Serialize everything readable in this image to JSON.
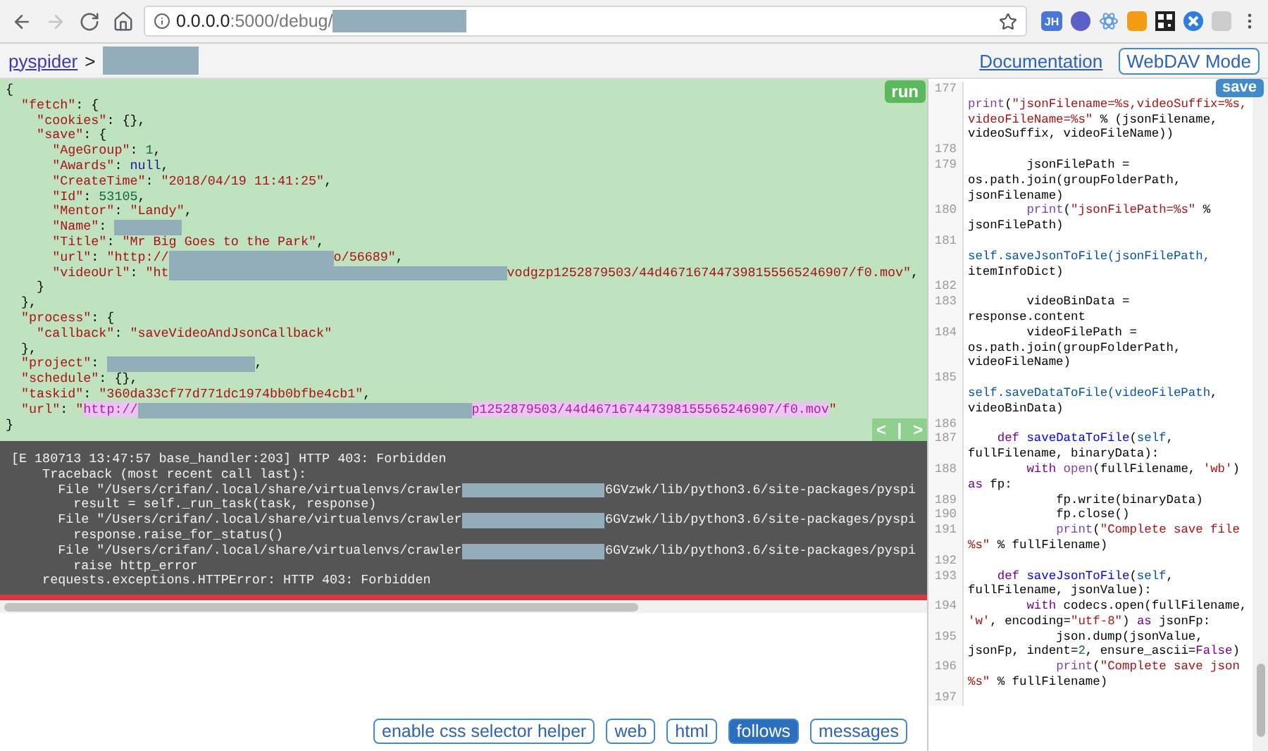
{
  "browser": {
    "nav_buttons": [
      {
        "kind": "back",
        "disabled": false
      },
      {
        "kind": "forward",
        "disabled": true
      },
      {
        "kind": "reload",
        "disabled": false
      },
      {
        "kind": "home",
        "disabled": false
      }
    ],
    "url": [
      {
        "kind": "host",
        "text": "0.0.0.0"
      },
      {
        "kind": "path",
        "text": ":5000/debug/"
      },
      {
        "kind": "redacted"
      }
    ],
    "extension_badge": "JH"
  },
  "header": {
    "breadcrumb": [
      {
        "kind": "link",
        "text": "pyspider"
      },
      {
        "kind": "text",
        "text": ">"
      },
      {
        "kind": "redacted"
      }
    ],
    "documentation_link": "Documentation",
    "webdav_button": "WebDAV Mode"
  },
  "task_editor": {
    "run_button": "run",
    "nav": [
      "<",
      "|",
      ">"
    ],
    "lines": [
      [
        {
          "kind": "plain",
          "text": "{"
        }
      ],
      [
        {
          "kind": "string",
          "text": "  \"fetch\""
        },
        {
          "kind": "plain",
          "text": ": {"
        }
      ],
      [
        {
          "kind": "string",
          "text": "    \"cookies\""
        },
        {
          "kind": "plain",
          "text": ": {},"
        }
      ],
      [
        {
          "kind": "string",
          "text": "    \"save\""
        },
        {
          "kind": "plain",
          "text": ": {"
        }
      ],
      [
        {
          "kind": "string",
          "text": "      \"AgeGroup\""
        },
        {
          "kind": "plain",
          "text": ": "
        },
        {
          "kind": "number",
          "text": "1"
        },
        {
          "kind": "plain",
          "text": ","
        }
      ],
      [
        {
          "kind": "string",
          "text": "      \"Awards\""
        },
        {
          "kind": "plain",
          "text": ": "
        },
        {
          "kind": "atom",
          "text": "null"
        },
        {
          "kind": "plain",
          "text": ","
        }
      ],
      [
        {
          "kind": "string",
          "text": "      \"CreateTime\""
        },
        {
          "kind": "plain",
          "text": ": "
        },
        {
          "kind": "string",
          "text": "\"2018/04/19 11:41:25\""
        },
        {
          "kind": "plain",
          "text": ","
        }
      ],
      [
        {
          "kind": "string",
          "text": "      \"Id\""
        },
        {
          "kind": "plain",
          "text": ": "
        },
        {
          "kind": "number",
          "text": "53105"
        },
        {
          "kind": "plain",
          "text": ","
        }
      ],
      [
        {
          "kind": "string",
          "text": "      \"Mentor\""
        },
        {
          "kind": "plain",
          "text": ": "
        },
        {
          "kind": "string",
          "text": "\"Landy\""
        },
        {
          "kind": "plain",
          "text": ","
        }
      ],
      [
        {
          "kind": "string",
          "text": "      \"Name\""
        },
        {
          "kind": "plain",
          "text": ": "
        },
        {
          "kind": "redacted"
        }
      ],
      [
        {
          "kind": "string",
          "text": "      \"Title\""
        },
        {
          "kind": "plain",
          "text": ": "
        },
        {
          "kind": "string",
          "text": "\"Mr Big Goes to the Park\""
        },
        {
          "kind": "plain",
          "text": ","
        }
      ],
      [
        {
          "kind": "string",
          "text": "      \"url\""
        },
        {
          "kind": "plain",
          "text": ": "
        },
        {
          "kind": "string",
          "text": "\"http://"
        },
        {
          "kind": "redacted"
        },
        {
          "kind": "string",
          "text": "o/56689\""
        },
        {
          "kind": "plain",
          "text": ","
        }
      ],
      [
        {
          "kind": "string",
          "text": "      \"videoUrl\""
        },
        {
          "kind": "plain",
          "text": ": "
        },
        {
          "kind": "string",
          "text": "\"ht"
        },
        {
          "kind": "redacted"
        },
        {
          "kind": "string",
          "text": "vodgzp1252879503/44d467167447398155565246907/f0.mov\""
        },
        {
          "kind": "plain",
          "text": ","
        }
      ],
      [
        {
          "kind": "plain",
          "text": "    }"
        }
      ],
      [
        {
          "kind": "plain",
          "text": "  },"
        }
      ],
      [
        {
          "kind": "string",
          "text": "  \"process\""
        },
        {
          "kind": "plain",
          "text": ": {"
        }
      ],
      [
        {
          "kind": "string",
          "text": "    \"callback\""
        },
        {
          "kind": "plain",
          "text": ": "
        },
        {
          "kind": "string",
          "text": "\"saveVideoAndJsonCallback\""
        }
      ],
      [
        {
          "kind": "plain",
          "text": "  },"
        }
      ],
      [
        {
          "kind": "string",
          "text": "  \"project\""
        },
        {
          "kind": "plain",
          "text": ": "
        },
        {
          "kind": "redacted"
        },
        {
          "kind": "plain",
          "text": ","
        }
      ],
      [
        {
          "kind": "string",
          "text": "  \"schedule\""
        },
        {
          "kind": "plain",
          "text": ": {},"
        }
      ],
      [
        {
          "kind": "string",
          "text": "  \"taskid\""
        },
        {
          "kind": "plain",
          "text": ": "
        },
        {
          "kind": "string",
          "text": "\"360da33cf77d771dc1974bb0bfbe4cb1\""
        },
        {
          "kind": "plain",
          "text": ","
        }
      ],
      [
        {
          "kind": "string",
          "text": "  \"url\""
        },
        {
          "kind": "plain",
          "text": ": "
        },
        {
          "kind": "string",
          "text": "\""
        },
        {
          "kind": "marked",
          "text": "http://"
        },
        {
          "kind": "redacted"
        },
        {
          "kind": "marked",
          "text": "p1252879503/44d467167447398155565246907/f0.mov"
        },
        {
          "kind": "string",
          "text": "\""
        }
      ],
      [
        {
          "kind": "plain",
          "text": "}"
        }
      ]
    ]
  },
  "log": {
    "lines": [
      [
        {
          "kind": "plain",
          "text": "[E 180713 13:47:57 base_handler:203] HTTP 403: Forbidden"
        }
      ],
      [
        {
          "kind": "plain",
          "text": "    Traceback (most recent call last):"
        }
      ],
      [
        {
          "kind": "plain",
          "text": "      File \"/Users/crifan/.local/share/virtualenvs/crawler"
        },
        {
          "kind": "redacted"
        },
        {
          "kind": "plain",
          "text": "6GVzwk/lib/python3.6/site-packages/pyspi"
        }
      ],
      [
        {
          "kind": "plain",
          "text": "        result = self._run_task(task, response)"
        }
      ],
      [
        {
          "kind": "plain",
          "text": "      File \"/Users/crifan/.local/share/virtualenvs/crawler"
        },
        {
          "kind": "redacted"
        },
        {
          "kind": "plain",
          "text": "6GVzwk/lib/python3.6/site-packages/pyspi"
        }
      ],
      [
        {
          "kind": "plain",
          "text": "        response.raise_for_status()"
        }
      ],
      [
        {
          "kind": "plain",
          "text": "      File \"/Users/crifan/.local/share/virtualenvs/crawler"
        },
        {
          "kind": "redacted"
        },
        {
          "kind": "plain",
          "text": "6GVzwk/lib/python3.6/site-packages/pyspi"
        }
      ],
      [
        {
          "kind": "plain",
          "text": "        raise http_error"
        }
      ],
      [
        {
          "kind": "plain",
          "text": "    requests.exceptions.HTTPError: HTTP 403: Forbidden"
        }
      ]
    ]
  },
  "tabs": [
    {
      "label": "enable css selector helper",
      "selected": false
    },
    {
      "label": "web",
      "selected": false
    },
    {
      "label": "html",
      "selected": false
    },
    {
      "label": "follows",
      "selected": true
    },
    {
      "label": "messages",
      "selected": false
    }
  ],
  "code_editor": {
    "save_button": "save",
    "lines": [
      {
        "number": "177",
        "tokens": [
          {
            "kind": "builtin",
            "text": "print"
          },
          {
            "kind": "plain",
            "text": "("
          },
          {
            "kind": "string",
            "text": "\"jsonFilename=%s,videoSuffix=%s,videoFileName=%s\""
          },
          {
            "kind": "plain",
            "text": " % (jsonFilename, videoSuffix, videoFileName))"
          }
        ]
      },
      {
        "number": "178"
      },
      {
        "number": "179",
        "tokens": [
          {
            "kind": "plain",
            "text": "        jsonFilePath = os.path.join(groupFolderPath, jsonFilename)"
          }
        ]
      },
      {
        "number": "180",
        "tokens": [
          {
            "kind": "builtin",
            "text": "        print"
          },
          {
            "kind": "plain",
            "text": "("
          },
          {
            "kind": "string",
            "text": "\"jsonFilePath=%s\""
          },
          {
            "kind": "plain",
            "text": " % jsonFilePath)"
          }
        ]
      },
      {
        "number": "181",
        "tokens": [
          {
            "kind": "variable",
            "text": "            self.saveJsonToFile(jsonFilePath,"
          },
          {
            "kind": "plain",
            "text": " itemInfoDict)"
          }
        ]
      },
      {
        "number": "182"
      },
      {
        "number": "183",
        "tokens": [
          {
            "kind": "plain",
            "text": "        videoBinData = response.content"
          }
        ]
      },
      {
        "number": "184",
        "tokens": [
          {
            "kind": "plain",
            "text": "        videoFilePath = os.path.join(groupFolderPath, videoFileName)"
          }
        ]
      },
      {
        "number": "185",
        "tokens": [
          {
            "kind": "variable",
            "text": "            self.saveDataToFile(videoFilePath"
          },
          {
            "kind": "plain",
            "text": ", videoBinData)"
          }
        ]
      },
      {
        "number": "186"
      },
      {
        "number": "187",
        "tokens": [
          {
            "kind": "keyword",
            "text": "    def"
          },
          {
            "kind": "def",
            "text": " saveDataToFile"
          },
          {
            "kind": "plain",
            "text": "("
          },
          {
            "kind": "variable",
            "text": "self"
          },
          {
            "kind": "plain",
            "text": ", fullFilename, binaryData):"
          }
        ]
      },
      {
        "number": "188",
        "tokens": [
          {
            "kind": "keyword",
            "text": "        with"
          },
          {
            "kind": "builtin",
            "text": " open"
          },
          {
            "kind": "plain",
            "text": "(fullFilename, "
          },
          {
            "kind": "string",
            "text": "'wb'"
          },
          {
            "kind": "plain",
            "text": ") "
          },
          {
            "kind": "keyword",
            "text": "as"
          },
          {
            "kind": "plain",
            "text": " fp:"
          }
        ]
      },
      {
        "number": "189",
        "tokens": [
          {
            "kind": "plain",
            "text": "            fp.write(binaryData)"
          }
        ]
      },
      {
        "number": "190",
        "tokens": [
          {
            "kind": "plain",
            "text": "            fp.close()"
          }
        ]
      },
      {
        "number": "191",
        "tokens": [
          {
            "kind": "builtin",
            "text": "            print"
          },
          {
            "kind": "plain",
            "text": "("
          },
          {
            "kind": "string",
            "text": "\"Complete save file %s\""
          },
          {
            "kind": "plain",
            "text": " % fullFilename)"
          }
        ]
      },
      {
        "number": "192"
      },
      {
        "number": "193",
        "tokens": [
          {
            "kind": "keyword",
            "text": "    def"
          },
          {
            "kind": "def",
            "text": " saveJsonToFile"
          },
          {
            "kind": "plain",
            "text": "("
          },
          {
            "kind": "variable",
            "text": "self"
          },
          {
            "kind": "plain",
            "text": ", fullFilename, jsonValue):"
          }
        ]
      },
      {
        "number": "194",
        "tokens": [
          {
            "kind": "keyword",
            "text": "        with"
          },
          {
            "kind": "plain",
            "text": " codecs.open(fullFilename, "
          },
          {
            "kind": "string",
            "text": "'w'"
          },
          {
            "kind": "plain",
            "text": ", encoding="
          },
          {
            "kind": "string",
            "text": "\"utf-8\""
          },
          {
            "kind": "plain",
            "text": ") "
          },
          {
            "kind": "keyword",
            "text": "as"
          },
          {
            "kind": "plain",
            "text": " jsonFp:"
          }
        ]
      },
      {
        "number": "195",
        "tokens": [
          {
            "kind": "plain",
            "text": "            json.dump(jsonValue, jsonFp, indent="
          },
          {
            "kind": "number",
            "text": "2"
          },
          {
            "kind": "plain",
            "text": ", ensure_ascii="
          },
          {
            "kind": "keyword",
            "text": "False"
          },
          {
            "kind": "plain",
            "text": ")"
          }
        ]
      },
      {
        "number": "196",
        "tokens": [
          {
            "kind": "builtin",
            "text": "            print"
          },
          {
            "kind": "plain",
            "text": "("
          },
          {
            "kind": "string",
            "text": "\"Complete save json %s\""
          },
          {
            "kind": "plain",
            "text": " % fullFilename)"
          }
        ]
      },
      {
        "number": "197"
      }
    ]
  }
}
